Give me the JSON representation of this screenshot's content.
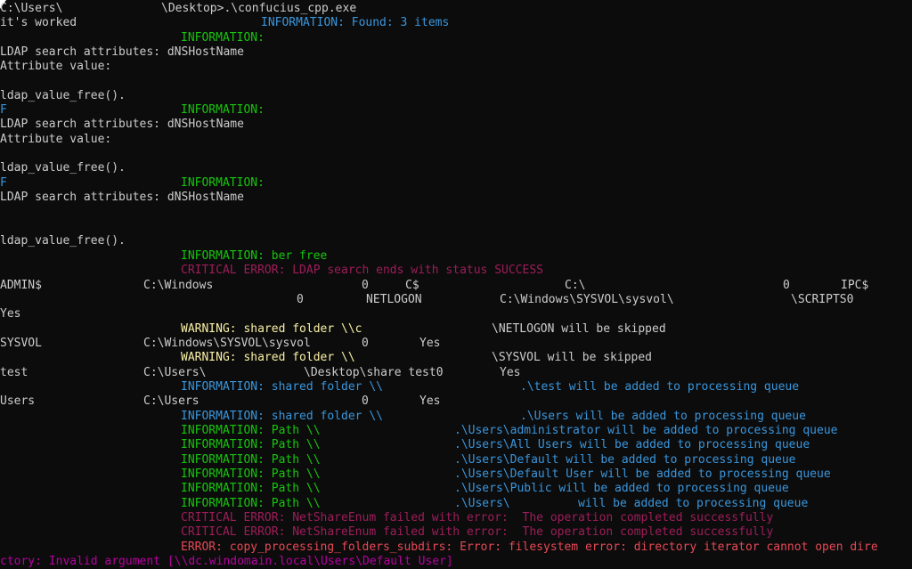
{
  "terminal": {
    "prompt": "C:\\Users\\",
    "prompt_cont": "\\Desktop>.\\confucius_cpp.exe",
    "worked": "it's worked",
    "info_found": "INFORMATION: Found: 3 items",
    "information": "INFORMATION:",
    "ldap_attrs": "LDAP search attributes: dNSHostName",
    "attr_value": "Attribute value:",
    "ldap_free": "ldap_value_free().",
    "ber_free": "INFORMATION: ber free",
    "critical_ldap": "CRITICAL ERROR: LDAP search ends with status SUCCESS",
    "shares": {
      "admin_name": "ADMIN$",
      "admin_path": "C:\\Windows",
      "admin_type": "0",
      "c_name": "C$",
      "c_path": "C:\\",
      "c_type": "0",
      "ipc_name": "IPC$",
      "ipc_type": "0",
      "netlogon_name": "NETLOGON",
      "netlogon_path": "C:\\Windows\\SYSVOL\\sysvol\\",
      "scripts": "\\SCRIPTS0",
      "yes": "Yes",
      "sysvol_name": "SYSVOL",
      "sysvol_path": "C:\\Windows\\SYSVOL\\sysvol",
      "sysvol_type": "0",
      "test_name": "test",
      "test_path_a": "C:\\Users\\",
      "test_path_b": "\\Desktop\\share test0",
      "users_name": "Users",
      "users_path": "C:\\Users",
      "users_type": "0"
    },
    "warn_netlogon_a": "WARNING: shared folder \\\\c",
    "warn_netlogon_b": "\\NETLOGON will be skipped",
    "warn_sysvol_a": "WARNING: shared folder \\\\",
    "warn_sysvol_b": "\\SYSVOL will be skipped",
    "info_test_a": "INFORMATION: shared folder \\\\",
    "info_test_b": ".\\test will be added to processing queue",
    "info_users_a": "INFORMATION: shared folder \\\\",
    "info_users_b": ".\\Users will be added to processing queue",
    "path_prefix": "INFORMATION: Path \\\\",
    "path_admin": ".\\Users\\administrator will be added to processing queue",
    "path_all": ".\\Users\\All Users will be added to processing queue",
    "path_default": ".\\Users\\Default will be added to processing queue",
    "path_default_user": ".\\Users\\Default User will be added to processing queue",
    "path_public": ".\\Users\\Public will be added to processing queue",
    "path_users_b": "will be added to processing queue",
    "path_users_a": ".\\Users\\",
    "crit_netshare_1": "CRITICAL ERROR: NetShareEnum failed with error:  The operation completed successfully",
    "crit_netshare_2": "CRITICAL ERROR: NetShareEnum failed with error:  The operation completed successfully",
    "error_line": "ERROR: copy_processing_folders_subdirs: Error: filesystem error: directory iterator cannot open dire",
    "error_wrap": "ctory: Invalid argument [\\\\dc.windomain.local\\Users\\Default User]",
    "glyph_f": "F"
  }
}
